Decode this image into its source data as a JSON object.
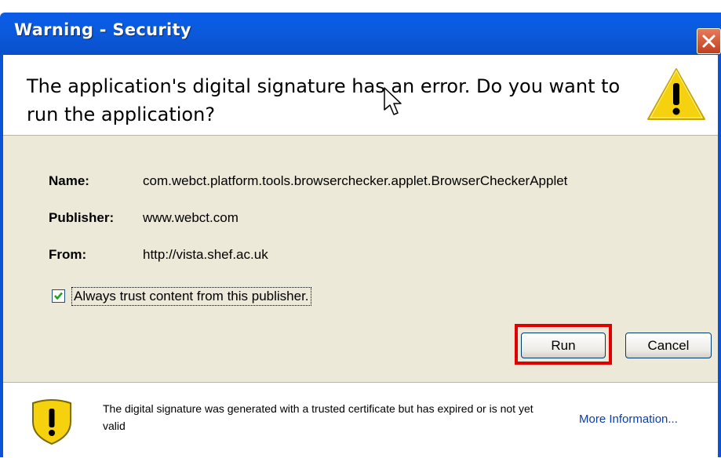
{
  "window": {
    "title": "Warning - Security"
  },
  "header": {
    "message": "The application's digital signature has an error.  Do you want to run the application?"
  },
  "details": {
    "name_label": "Name:",
    "name_value": "com.webct.platform.tools.browserchecker.applet.BrowserCheckerApplet",
    "publisher_label": "Publisher:",
    "publisher_value": "www.webct.com",
    "from_label": "From:",
    "from_value": "http://vista.shef.ac.uk"
  },
  "trust_checkbox": {
    "label": "Always trust content from this publisher.",
    "checked": true
  },
  "buttons": {
    "run_label": "Run",
    "cancel_label": "Cancel"
  },
  "footer": {
    "message": "The digital signature was generated with a trusted certificate but has expired or is not yet valid",
    "more_info_link": "More Information..."
  },
  "colors": {
    "title_bar": "#0a5ce8",
    "highlight": "#e00000",
    "warning_yellow": "#f5d20d"
  },
  "icons": [
    "close-icon",
    "warning-icon",
    "mouse-cursor-icon",
    "checkmark-icon"
  ]
}
